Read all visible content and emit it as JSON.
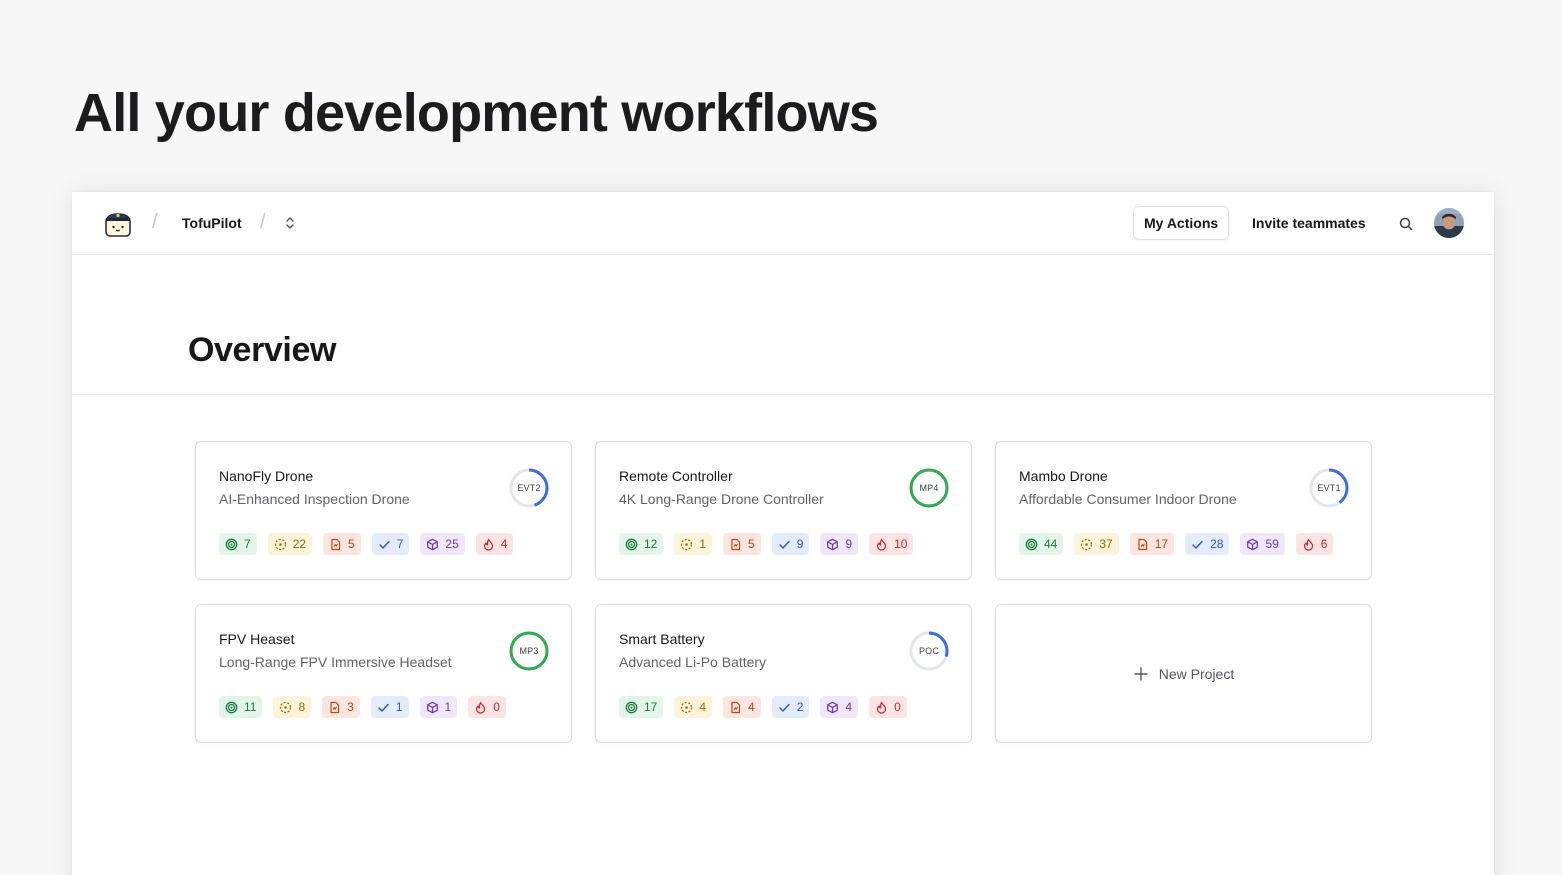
{
  "hero": {
    "title": "All your development workflows"
  },
  "topbar": {
    "org_name": "TofuPilot",
    "my_actions": "My Actions",
    "invite": "Invite teammates"
  },
  "page": {
    "title": "Overview"
  },
  "colors": {
    "ring_blue": "#3b6fe0",
    "ring_green": "#34a853",
    "ring_track": "#e3e6ee"
  },
  "projects": [
    {
      "name": "NanoFly Drone",
      "desc": "AI-Enhanced Inspection Drone",
      "stage": "EVT2",
      "progress": 0.45,
      "ring": "blue",
      "counts": [
        "7",
        "22",
        "5",
        "7",
        "25",
        "4"
      ]
    },
    {
      "name": "Remote Controller",
      "desc": "4K Long-Range Drone Controller",
      "stage": "MP4",
      "progress": 1.0,
      "ring": "green",
      "counts": [
        "12",
        "1",
        "5",
        "9",
        "9",
        "10"
      ]
    },
    {
      "name": "Mambo Drone",
      "desc": "Affordable Consumer Indoor Drone",
      "stage": "EVT1",
      "progress": 0.4,
      "ring": "blue",
      "counts": [
        "44",
        "37",
        "17",
        "28",
        "59",
        "6"
      ]
    },
    {
      "name": "FPV Heaset",
      "desc": "Long-Range FPV Immersive Headset",
      "stage": "MP3",
      "progress": 1.0,
      "ring": "green",
      "counts": [
        "11",
        "8",
        "3",
        "1",
        "1",
        "0"
      ]
    },
    {
      "name": "Smart Battery",
      "desc": "Advanced Li-Po Battery",
      "stage": "POC",
      "progress": 0.3,
      "ring": "blue",
      "counts": [
        "17",
        "4",
        "4",
        "2",
        "4",
        "0"
      ]
    }
  ],
  "badge_types": [
    "target-icon",
    "component-icon",
    "report-icon",
    "check-icon",
    "cube-icon",
    "flame-icon"
  ],
  "new_project": {
    "label": "New Project"
  }
}
